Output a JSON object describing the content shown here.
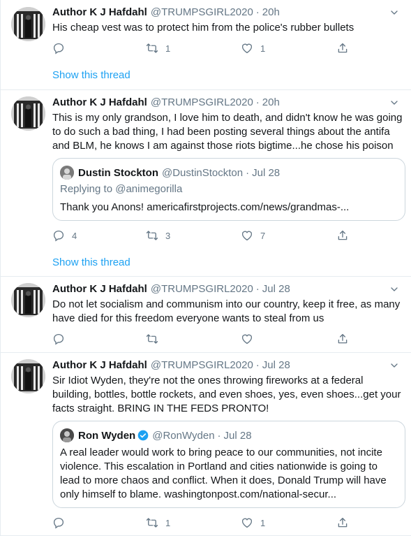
{
  "tweets": [
    {
      "name": "Author K J Hafdahl",
      "handle": "@TRUMPSGIRL2020",
      "dot": "·",
      "time": "20h",
      "text": "His cheap vest was to protect him from the police's rubber bullets",
      "reply_count": "",
      "retweet_count": "1",
      "like_count": "1",
      "show_thread": "Show this thread"
    },
    {
      "name": "Author K J Hafdahl",
      "handle": "@TRUMPSGIRL2020",
      "dot": "·",
      "time": "20h",
      "text": "This is my only grandson, I love him to death, and didn't know he was going to do such  a bad thing, I had been posting several things about the antifa and BLM, he knows I am against those riots bigtime...he chose his poison",
      "quote": {
        "name": "Dustin Stockton",
        "handle": "@DustinStockton",
        "dot": "·",
        "time": "Jul 28",
        "replying": "Replying to @animegorilla",
        "text": "Thank you Anons! americafirstprojects.com/news/grandmas-..."
      },
      "reply_count": "4",
      "retweet_count": "3",
      "like_count": "7",
      "show_thread": "Show this thread"
    },
    {
      "name": "Author K J Hafdahl",
      "handle": "@TRUMPSGIRL2020",
      "dot": "·",
      "time": "Jul 28",
      "text": "Do not let socialism and communism into our country, keep it free, as many have died for this freedom everyone wants to steal from us",
      "reply_count": "",
      "retweet_count": "",
      "like_count": ""
    },
    {
      "name": "Author K J Hafdahl",
      "handle": "@TRUMPSGIRL2020",
      "dot": "·",
      "time": "Jul 28",
      "text": "Sir Idiot Wyden, they're not the ones throwing fireworks at a federal building, bottles, bottle rockets, and even shoes, yes, even shoes...get your facts straight.  BRING IN THE FEDS PRONTO!",
      "quote": {
        "name": "Ron Wyden",
        "handle": "@RonWyden",
        "dot": "·",
        "time": "Jul 28",
        "text": "A real leader would work to bring peace to our communities, not incite violence. This escalation in Portland and cities nationwide is going to lead to more chaos and conflict. When it does, Donald Trump will have only himself to blame. washingtonpost.com/national-secur..."
      },
      "reply_count": "",
      "retweet_count": "1",
      "like_count": "1"
    }
  ],
  "colors": {
    "accent": "#1da1f2",
    "secondary_text": "#657786",
    "border": "#e6ecf0"
  },
  "icons": [
    "reply-icon",
    "retweet-icon",
    "like-icon",
    "share-icon",
    "caret-down-icon",
    "verified-badge-icon"
  ]
}
